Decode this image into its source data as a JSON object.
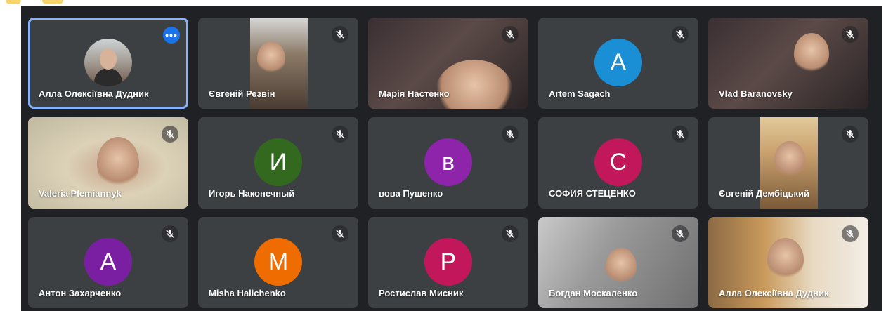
{
  "icons": {
    "mute": "mic-off-icon",
    "more": "more-options-icon"
  },
  "colors": {
    "tile_bg": "#3c4043",
    "active_outline": "#8ab4f8",
    "more_button": "#1a73e8"
  },
  "participants": [
    {
      "name": "Алла Олексіївна Дудник",
      "kind": "photo",
      "active": true,
      "more_label": "•••"
    },
    {
      "name": "Євгеній Резвін",
      "kind": "video",
      "video": "street"
    },
    {
      "name": "Марія Настенко",
      "kind": "video",
      "video": "dark"
    },
    {
      "name": "Artem Sagach",
      "kind": "initial",
      "initial": "A",
      "color": "#1a8fd6"
    },
    {
      "name": "Vlad Baranovsky",
      "kind": "video",
      "video": "dark"
    },
    {
      "name": "Valeria Plemiannyk",
      "kind": "video",
      "video": "cream"
    },
    {
      "name": "Игорь Наконечный",
      "kind": "initial",
      "initial": "И",
      "color": "#33691e"
    },
    {
      "name": "вова Пушенко",
      "kind": "initial",
      "initial": "в",
      "color": "#8e24aa"
    },
    {
      "name": "СОФИЯ СТЕЦЕНКО",
      "kind": "initial",
      "initial": "С",
      "color": "#c2185b"
    },
    {
      "name": "Євгеній Дембіцький",
      "kind": "video",
      "video": "wall"
    },
    {
      "name": "Антон Захарченко",
      "kind": "initial",
      "initial": "А",
      "color": "#7b1fa2"
    },
    {
      "name": "Misha Halichenko",
      "kind": "initial",
      "initial": "M",
      "color": "#ef6c00"
    },
    {
      "name": "Ростислав Мисник",
      "kind": "initial",
      "initial": "Р",
      "color": "#c2185b"
    },
    {
      "name": "Богдан Москаленко",
      "kind": "video",
      "video": "grey"
    },
    {
      "name": "Алла Олексіївна Дудник",
      "kind": "video",
      "video": "room"
    }
  ]
}
